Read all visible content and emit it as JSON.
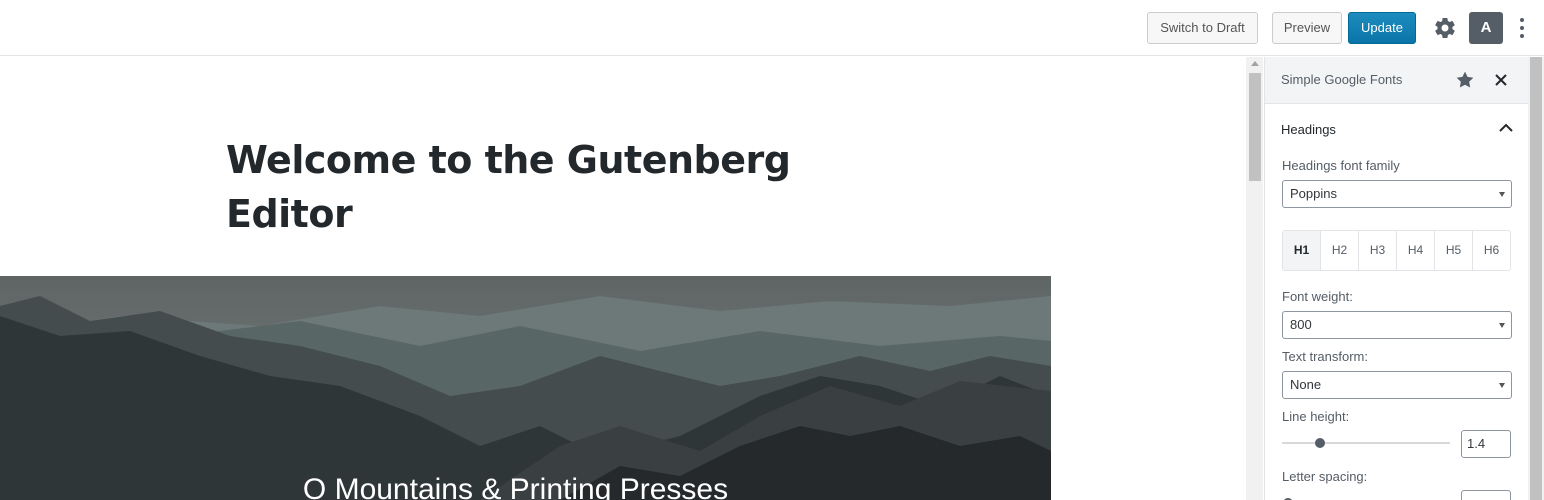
{
  "toolbar": {
    "switch_to_draft": "Switch to Draft",
    "preview": "Preview",
    "update": "Update",
    "avatar_letter": "A",
    "settings_icon": "gear-icon",
    "more_icon": "kebab-icon"
  },
  "editor": {
    "title_line1": "Welcome to the Gutenberg",
    "title_line2": "Editor",
    "cover_text": "O Mountains & Printing Presses"
  },
  "sidebar": {
    "plugin_title": "Simple Google Fonts",
    "panel_title": "Headings",
    "font_family_label": "Headings font family",
    "font_family_value": "Poppins",
    "heading_tabs": [
      "H1",
      "H2",
      "H3",
      "H4",
      "H5",
      "H6"
    ],
    "active_tab": "H1",
    "font_weight_label": "Font weight:",
    "font_weight_value": "800",
    "text_transform_label": "Text transform:",
    "text_transform_value": "None",
    "line_height_label": "Line height:",
    "line_height_value": "1.4",
    "letter_spacing_label": "Letter spacing:"
  },
  "colors": {
    "primary_button": "#0085ba",
    "avatar_bg": "#555d66",
    "title_text": "#23282d"
  }
}
